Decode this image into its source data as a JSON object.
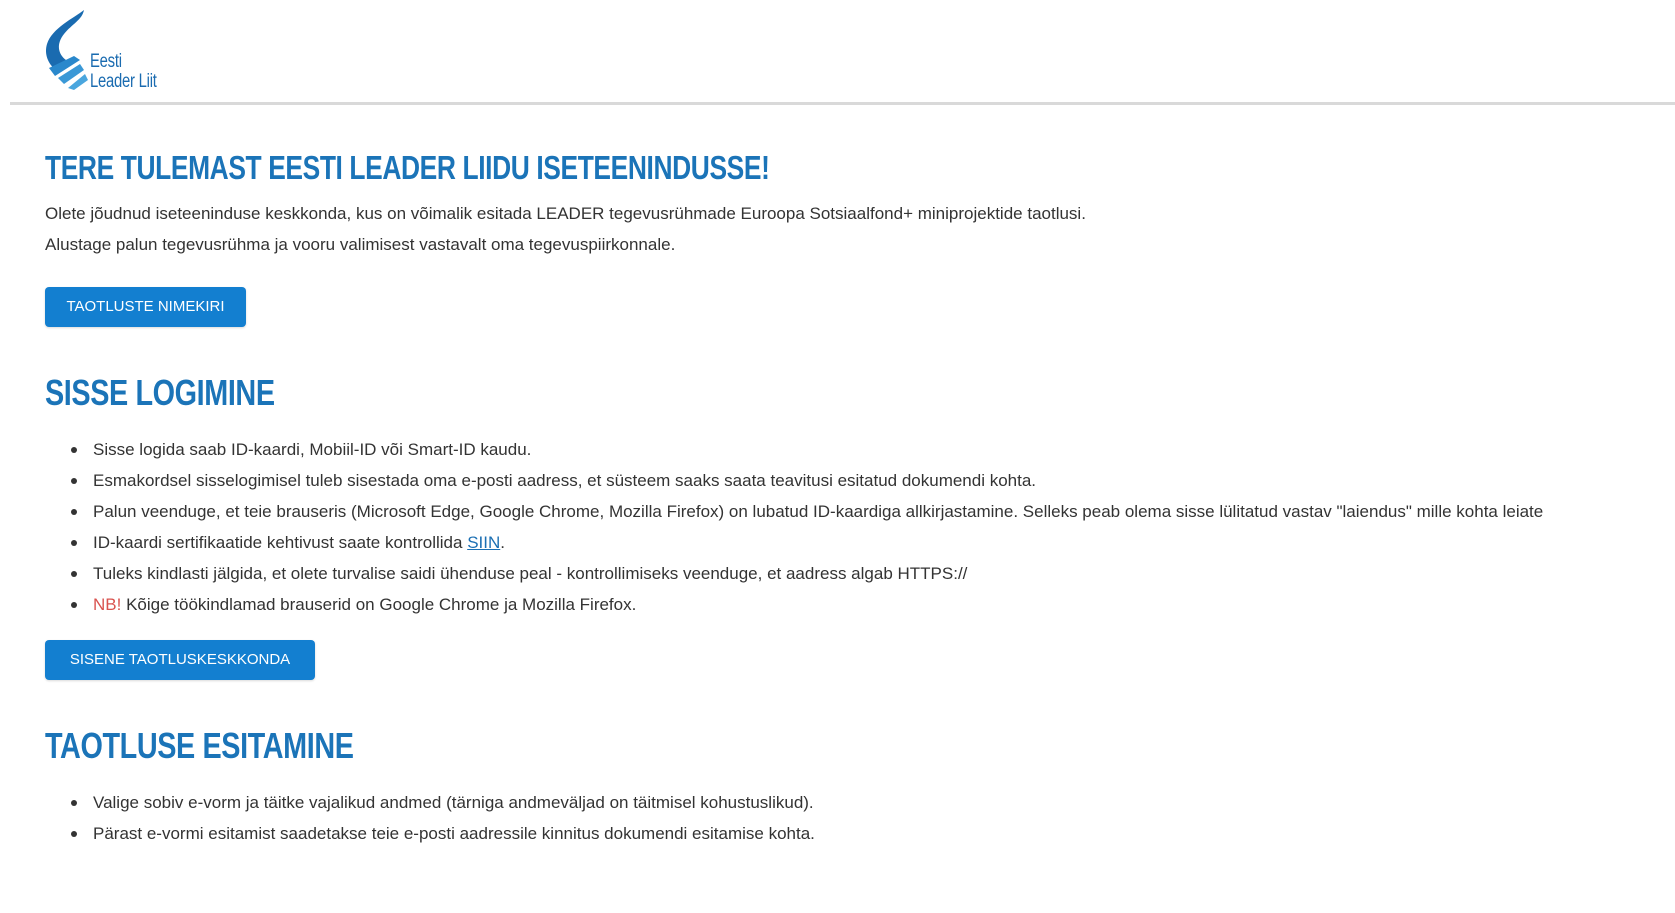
{
  "logo": {
    "line1": "Eesti",
    "line2": "Leader Liit",
    "color": "#1a6bb0"
  },
  "welcome": {
    "title": "TERE TULEMAST EESTI LEADER LIIDU ISETEENINDUSSE!",
    "paragraph1": "Olete jõudnud iseteeninduse keskkonda, kus on võimalik esitada LEADER tegevusrühmade Euroopa Sotsiaalfond+ miniprojektide taotlusi.",
    "paragraph2": "Alustage palun tegevusrühma ja vooru valimisest vastavalt oma tegevuspiirkonnale.",
    "button_label": "TAOTLUSTE NIMEKIRI"
  },
  "login": {
    "title": "SISSE LOGIMINE",
    "items": [
      "Sisse logida saab ID-kaardi, Mobiil-ID või Smart-ID kaudu.",
      "Esmakordsel sisselogimisel tuleb sisestada oma e-posti aadress, et süsteem saaks saata teavitusi esitatud dokumendi kohta.",
      "Palun veenduge, et teie brauseris (Microsoft Edge, Google Chrome,  Mozilla Firefox) on lubatud ID-kaardiga allkirjastamine. Selleks peab olema sisse lülitatud vastav \"laiendus\" mille kohta leiate",
      "ID-kaardi sertifikaatide kehtivust saate kontrollida",
      "Tuleks kindlasti jälgida, et olete turvalise saidi ühenduse peal - kontrollimiseks veenduge, et aadress algab HTTPS://",
      "Kõige töökindlamad brauserid on Google Chrome ja Mozilla Firefox."
    ],
    "link_label": "SIIN",
    "link_suffix": ".",
    "nb_label": "NB!",
    "button_label": "SISENE TAOTLUSKESKKONDA"
  },
  "submission": {
    "title": "TAOTLUSE ESITAMINE",
    "items": [
      "Valige sobiv e-vorm ja täitke vajalikud andmed (tärniga andmeväljad on täitmisel kohustuslikud).",
      "Pärast e-vormi esitamist saadetakse teie e-posti aadressile kinnitus dokumendi esitamise kohta."
    ]
  },
  "colors": {
    "heading": "#1b74b8",
    "button": "#137fd0",
    "link": "#1b6fb3",
    "nb": "#d9534f"
  }
}
